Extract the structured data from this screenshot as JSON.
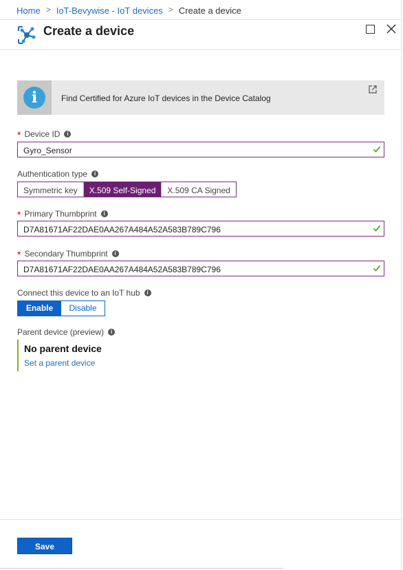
{
  "breadcrumb": {
    "items": [
      "Home",
      "IoT-Bevywise - IoT devices",
      "Create a device"
    ]
  },
  "header": {
    "title": "Create a device"
  },
  "banner": {
    "text": "Find Certified for Azure IoT devices in the Device Catalog",
    "icon_glyph": "i"
  },
  "device_id": {
    "label": "Device ID",
    "required_mark": "*",
    "value": "Gyro_Sensor"
  },
  "auth": {
    "label": "Authentication type",
    "options": [
      "Symmetric key",
      "X.509 Self-Signed",
      "X.509 CA Signed"
    ],
    "selected": "X.509 Self-Signed"
  },
  "primary_thumbprint": {
    "label": "Primary Thumbprint",
    "required_mark": "*",
    "value": "D7A81671AF22DAE0AA267A484A52A583B789C796"
  },
  "secondary_thumbprint": {
    "label": "Secondary Thumbprint",
    "required_mark": "*",
    "value": "D7A81671AF22DAE0AA267A484A52A583B789C796"
  },
  "connect": {
    "label": "Connect this device to an IoT hub",
    "options": [
      "Enable",
      "Disable"
    ],
    "selected": "Enable"
  },
  "parent": {
    "label": "Parent device (preview)",
    "value": "No parent device",
    "link": "Set a parent device"
  },
  "footer": {
    "save_label": "Save"
  },
  "colors": {
    "accent_purple": "#6a1f72",
    "azure_blue": "#0e62c8",
    "valid_green": "#58a92b",
    "required_red": "#c4001a"
  },
  "icons": {
    "blade": "iot-hub-icon",
    "info": "info-icon",
    "external": "external-link-icon",
    "check": "checkmark-icon",
    "help": "info-circle-icon"
  }
}
